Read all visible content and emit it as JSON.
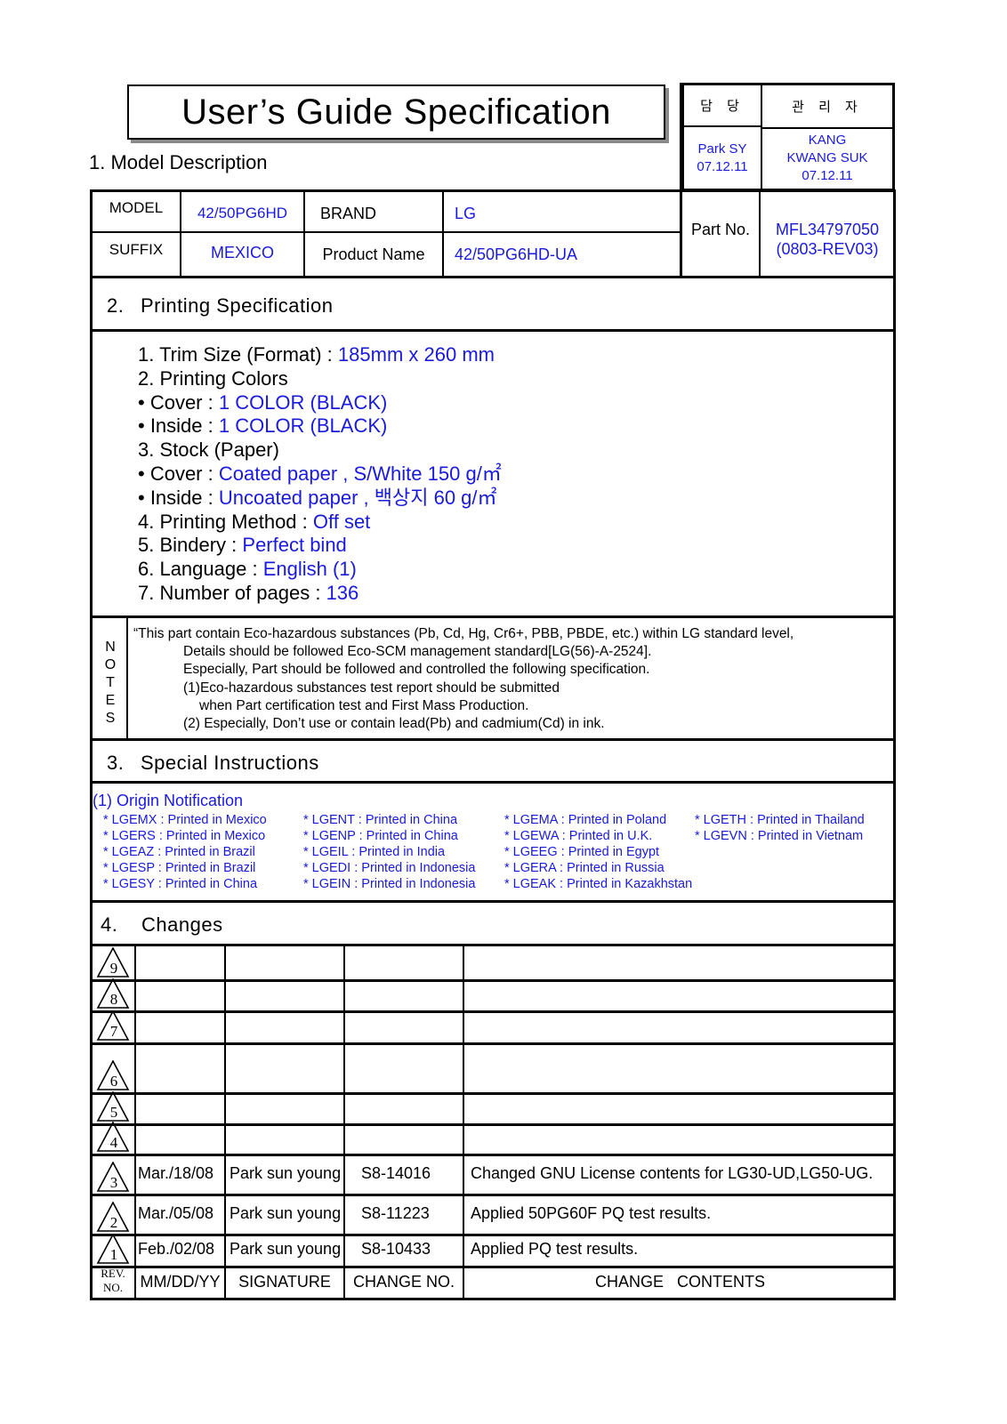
{
  "title": "User’s Guide Specification",
  "approval": {
    "col1_header": "담 당",
    "col2_header": "관 리 자",
    "col1_value_lines": [
      "Park SY",
      "07.12.11"
    ],
    "col2_value_lines": [
      "KANG",
      "KWANG SUK",
      "07.12.11"
    ]
  },
  "model_description": {
    "heading": "1. Model Description",
    "model_label": "MODEL",
    "model_value": "42/50PG6HD",
    "brand_label": "BRAND",
    "brand_value": "LG",
    "suffix_label": "SUFFIX",
    "suffix_value": "MEXICO",
    "product_name_label": "Product Name",
    "product_name_value": "42/50PG6HD-UA",
    "part_no_label": "Part No.",
    "part_no_value": "MFL34797050",
    "part_no_rev": "(0803-REV03)"
  },
  "printing_spec": {
    "num": "2.",
    "heading": "Printing Specification",
    "items": [
      {
        "label": "1. Trim Size (Format) : ",
        "value": "185mm x 260 mm"
      },
      {
        "label": "2. Printing Colors",
        "value": ""
      },
      {
        "label": "• Cover : ",
        "value": "1 COLOR (BLACK)"
      },
      {
        "label": "• Inside : ",
        "value": "1 COLOR (BLACK)"
      },
      {
        "label": "3. Stock (Paper)",
        "value": ""
      },
      {
        "label": "• Cover : ",
        "value": "Coated paper , S/White 150 g/㎡"
      },
      {
        "label": "• Inside : ",
        "value": "Uncoated paper , 백상지 60 g/㎡"
      },
      {
        "label": "4. Printing Method : ",
        "value": "Off set"
      },
      {
        "label": "5. Bindery  : ",
        "value": "Perfect bind"
      },
      {
        "label": "6. Language : ",
        "value": "English (1)"
      },
      {
        "label": "7. Number of pages : ",
        "value": "136"
      }
    ]
  },
  "notes": {
    "label_letters": [
      "N",
      "O",
      "T",
      "E",
      "S"
    ],
    "lines": [
      "“This part contain Eco-hazardous substances (Pb, Cd, Hg, Cr6+, PBB, PBDE, etc.) within LG standard level,",
      "Details should be followed Eco-SCM management standard[LG(56)-A-2524].",
      "Especially, Part should be followed and controlled the following specification.",
      "(1)Eco-hazardous substances test report should be submitted",
      "when  Part certification test and First Mass Production.",
      "(2) Especially, Don’t use or contain lead(Pb) and cadmium(Cd) in ink."
    ]
  },
  "special_instructions": {
    "num": "3.",
    "heading": "Special Instructions",
    "origin_title": "(1) Origin Notification",
    "origin_columns": [
      [
        "* LGEMX : Printed in Mexico",
        "* LGERS : Printed in Mexico",
        "* LGEAZ : Printed in Brazil",
        "* LGESP : Printed in Brazil",
        "* LGESY : Printed in China"
      ],
      [
        "* LGENT : Printed in China",
        "* LGENP : Printed in China",
        "* LGEIL : Printed in India",
        "* LGEDI : Printed in Indonesia",
        "* LGEIN : Printed in Indonesia"
      ],
      [
        "* LGEMA : Printed in Poland",
        "* LGEWA : Printed in U.K.",
        "* LGEEG : Printed in Egypt",
        "* LGERA : Printed in Russia",
        "* LGEAK : Printed in Kazakhstan"
      ],
      [
        "* LGETH : Printed in Thailand",
        "* LGEVN : Printed in Vietnam"
      ]
    ]
  },
  "changes": {
    "num": "4.",
    "heading": "Changes",
    "rows": [
      {
        "rev": "9",
        "date": "",
        "signature": "",
        "change_no": "",
        "contents": ""
      },
      {
        "rev": "8",
        "date": "",
        "signature": "",
        "change_no": "",
        "contents": ""
      },
      {
        "rev": "7",
        "date": "",
        "signature": "",
        "change_no": "",
        "contents": ""
      },
      {
        "rev": "6",
        "date": "",
        "signature": "",
        "change_no": "",
        "contents": ""
      },
      {
        "rev": "5",
        "date": "",
        "signature": "",
        "change_no": "",
        "contents": ""
      },
      {
        "rev": "4",
        "date": "",
        "signature": "",
        "change_no": "",
        "contents": ""
      },
      {
        "rev": "3",
        "date": "Mar./18/08",
        "signature": "Park sun young",
        "change_no": "S8-14016",
        "contents": "Changed GNU License contents for LG30-UD,LG50-UG."
      },
      {
        "rev": "2",
        "date": "Mar./05/08",
        "signature": "Park sun young",
        "change_no": "S8-11223",
        "contents": "Applied 50PG60F PQ test results."
      },
      {
        "rev": "1",
        "date": "Feb./02/08",
        "signature": "Park sun young",
        "change_no": "S8-10433",
        "contents": "Applied PQ test results."
      }
    ],
    "header": {
      "rev_line1": "REV.",
      "rev_line2": "NO.",
      "date": "MM/DD/YY",
      "signature": "SIGNATURE",
      "change_no": "CHANGE NO.",
      "contents": "CHANGE   CONTENTS"
    }
  }
}
